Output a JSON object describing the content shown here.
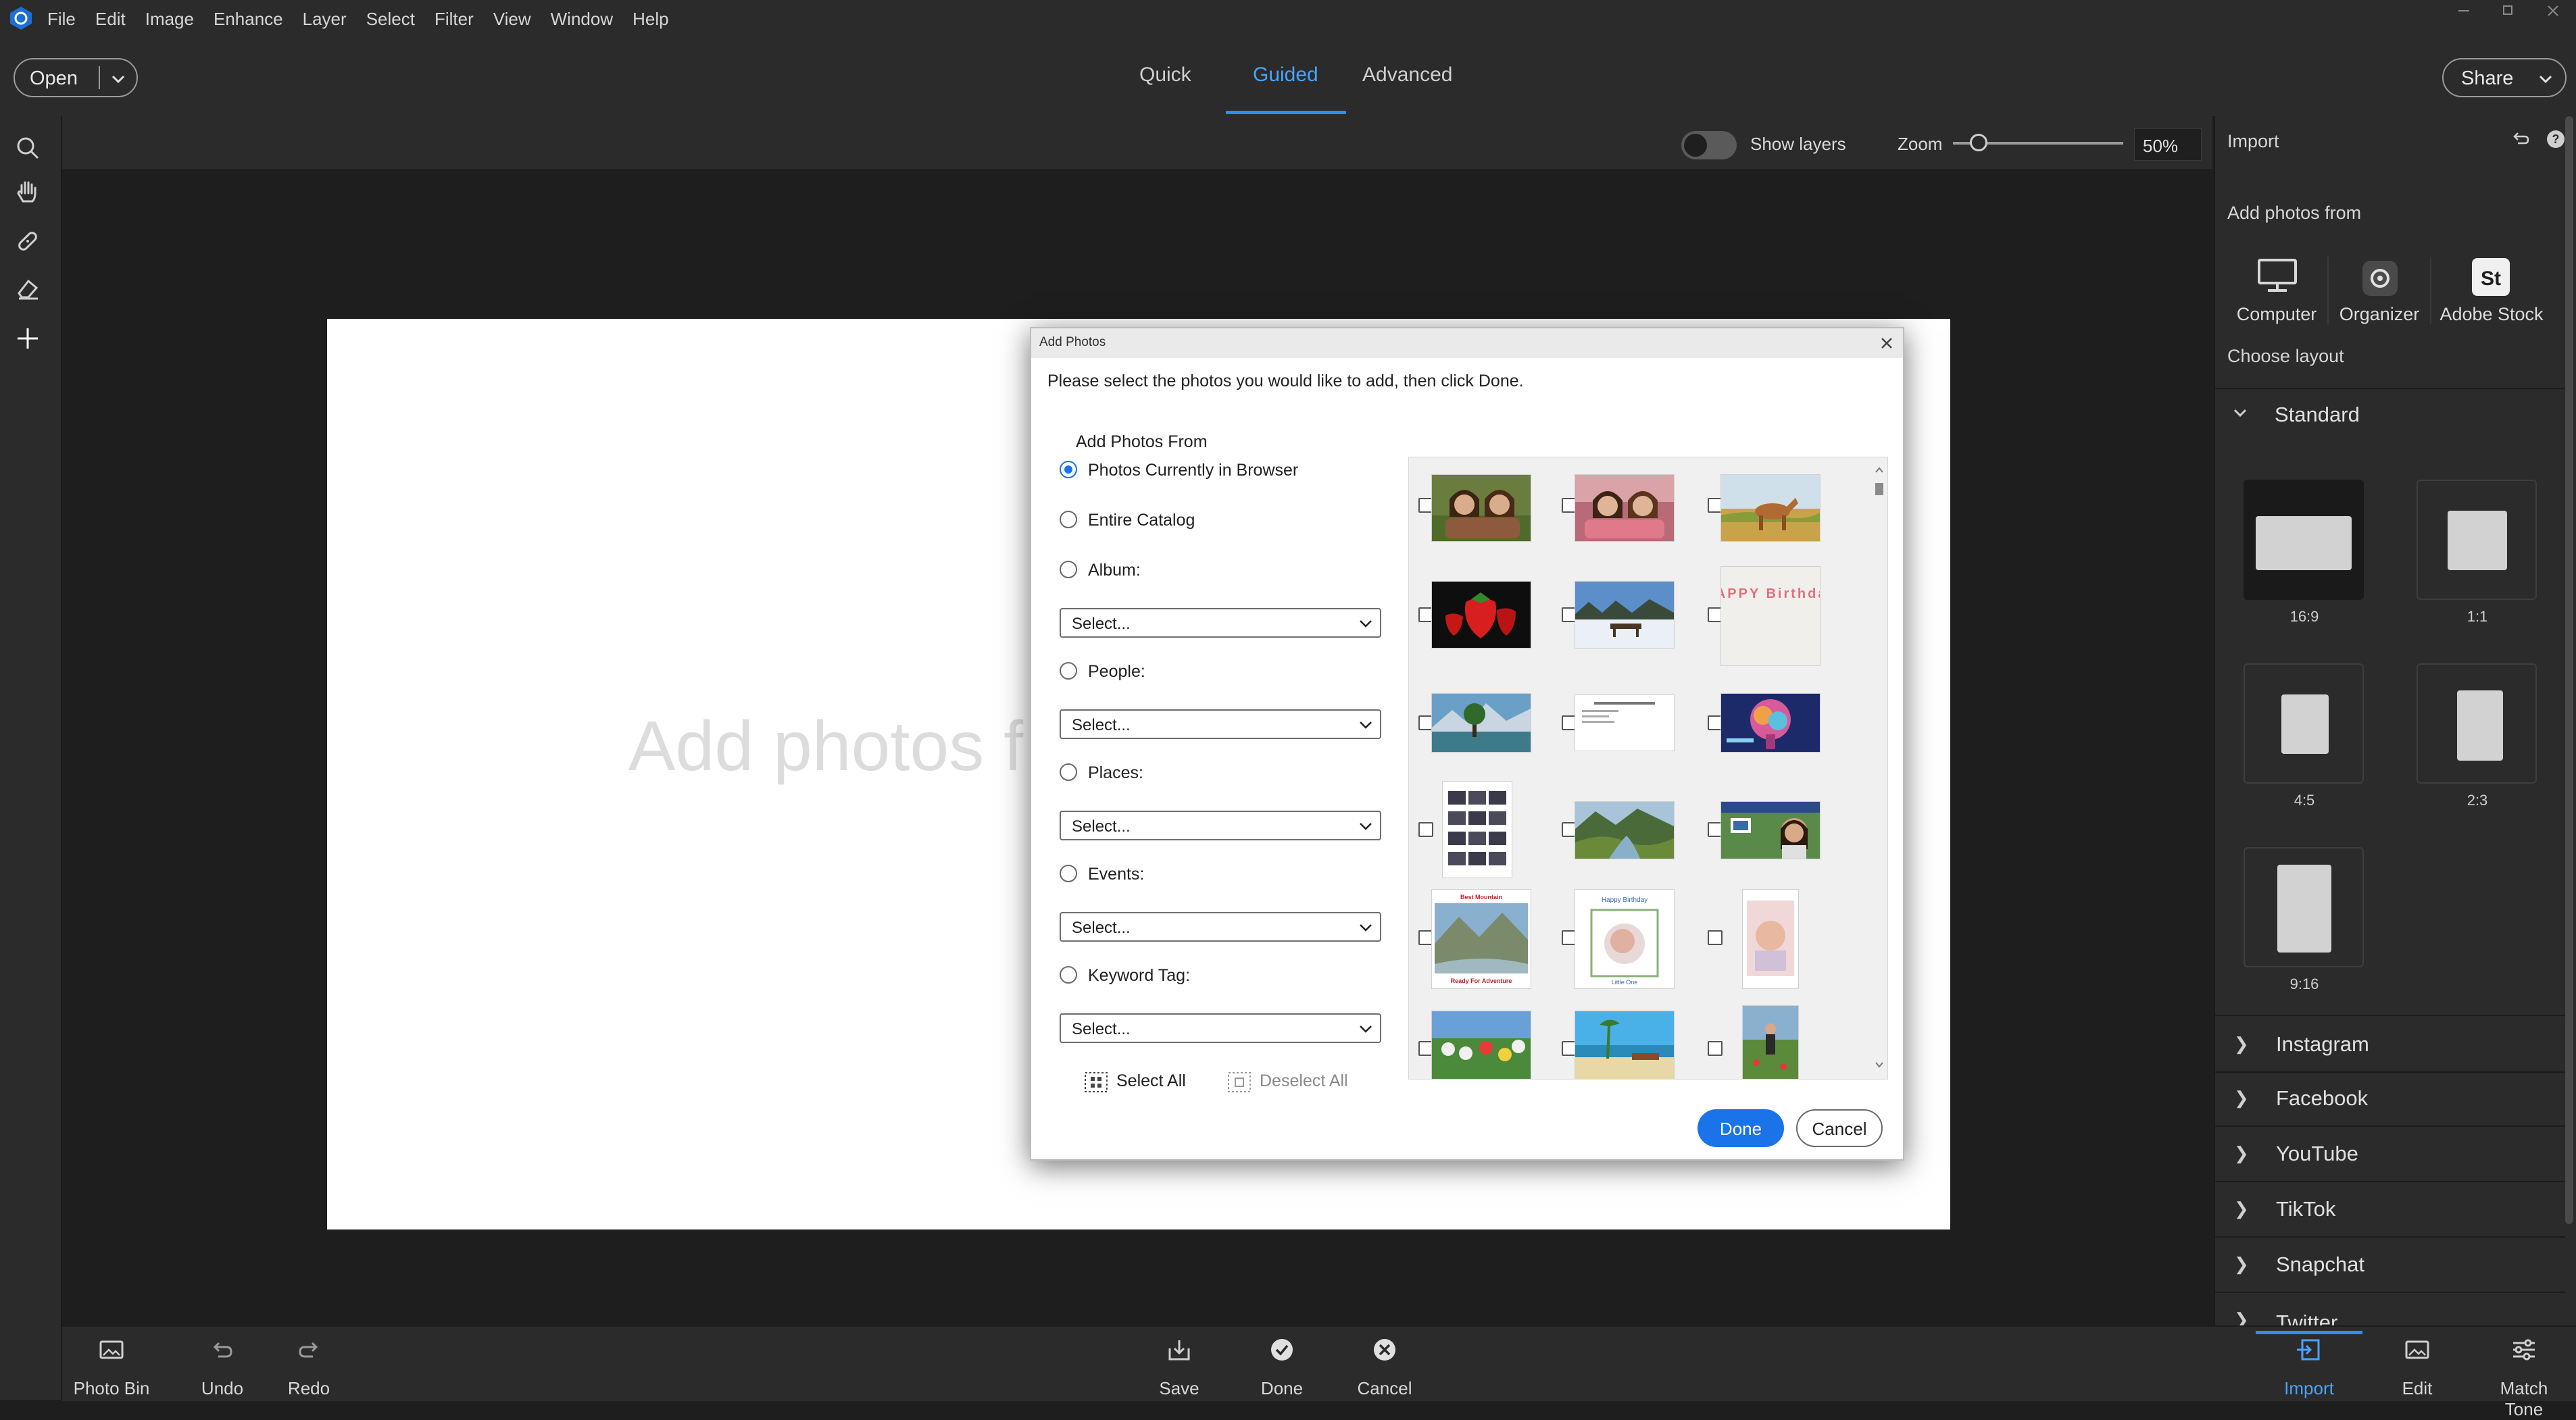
{
  "menu": [
    "File",
    "Edit",
    "Image",
    "Enhance",
    "Layer",
    "Select",
    "Filter",
    "View",
    "Window",
    "Help"
  ],
  "topbar": {
    "open_label": "Open",
    "modes": [
      "Quick",
      "Guided",
      "Advanced"
    ],
    "active_mode": "Guided",
    "share_label": "Share"
  },
  "options": {
    "show_layers_label": "Show layers",
    "show_layers_on": false,
    "zoom_label": "Zoom",
    "zoom_value": "50%",
    "zoom_level": 0.15
  },
  "canvas": {
    "placeholder": "Add photos f"
  },
  "right_panel": {
    "title": "Import",
    "add_from_label": "Add photos from",
    "sources": [
      "Computer",
      "Organizer",
      "Adobe Stock"
    ],
    "choose_layout_label": "Choose layout",
    "standard_label": "Standard",
    "layouts": [
      "16:9",
      "1:1",
      "4:5",
      "2:3",
      "9:16"
    ],
    "selected_layout": "16:9",
    "socials": [
      "Instagram",
      "Facebook",
      "YouTube",
      "TikTok",
      "Snapchat",
      "Twitter"
    ]
  },
  "bottombar": {
    "left": [
      "Photo Bin",
      "Undo",
      "Redo"
    ],
    "center": [
      "Save",
      "Done",
      "Cancel"
    ],
    "right": [
      "Import",
      "Edit",
      "Match Tone"
    ],
    "active": "Import"
  },
  "dialog": {
    "title": "Add Photos",
    "instruction": "Please select the photos you would like to add, then click Done.",
    "add_from_label": "Add Photos From",
    "options": [
      {
        "label": "Photos Currently in Browser",
        "selected": true,
        "has_dropdown": false
      },
      {
        "label": "Entire Catalog",
        "selected": false,
        "has_dropdown": false
      },
      {
        "label": "Album:",
        "selected": false,
        "has_dropdown": true
      },
      {
        "label": "People:",
        "selected": false,
        "has_dropdown": true
      },
      {
        "label": "Places:",
        "selected": false,
        "has_dropdown": true
      },
      {
        "label": "Events:",
        "selected": false,
        "has_dropdown": true
      },
      {
        "label": "Keyword Tag:",
        "selected": false,
        "has_dropdown": true
      }
    ],
    "dropdown_placeholder": "Select...",
    "select_all_label": "Select All",
    "deselect_all_label": "Deselect All",
    "done_label": "Done",
    "cancel_label": "Cancel",
    "thumb_text": {
      "birthday_card": "HAPPY Birthday",
      "mountain_top": "Best Mountain",
      "mountain_bottom": "Ready For Adventure",
      "baby_top": "Happy Birthday",
      "baby_bottom": "Little One"
    }
  }
}
